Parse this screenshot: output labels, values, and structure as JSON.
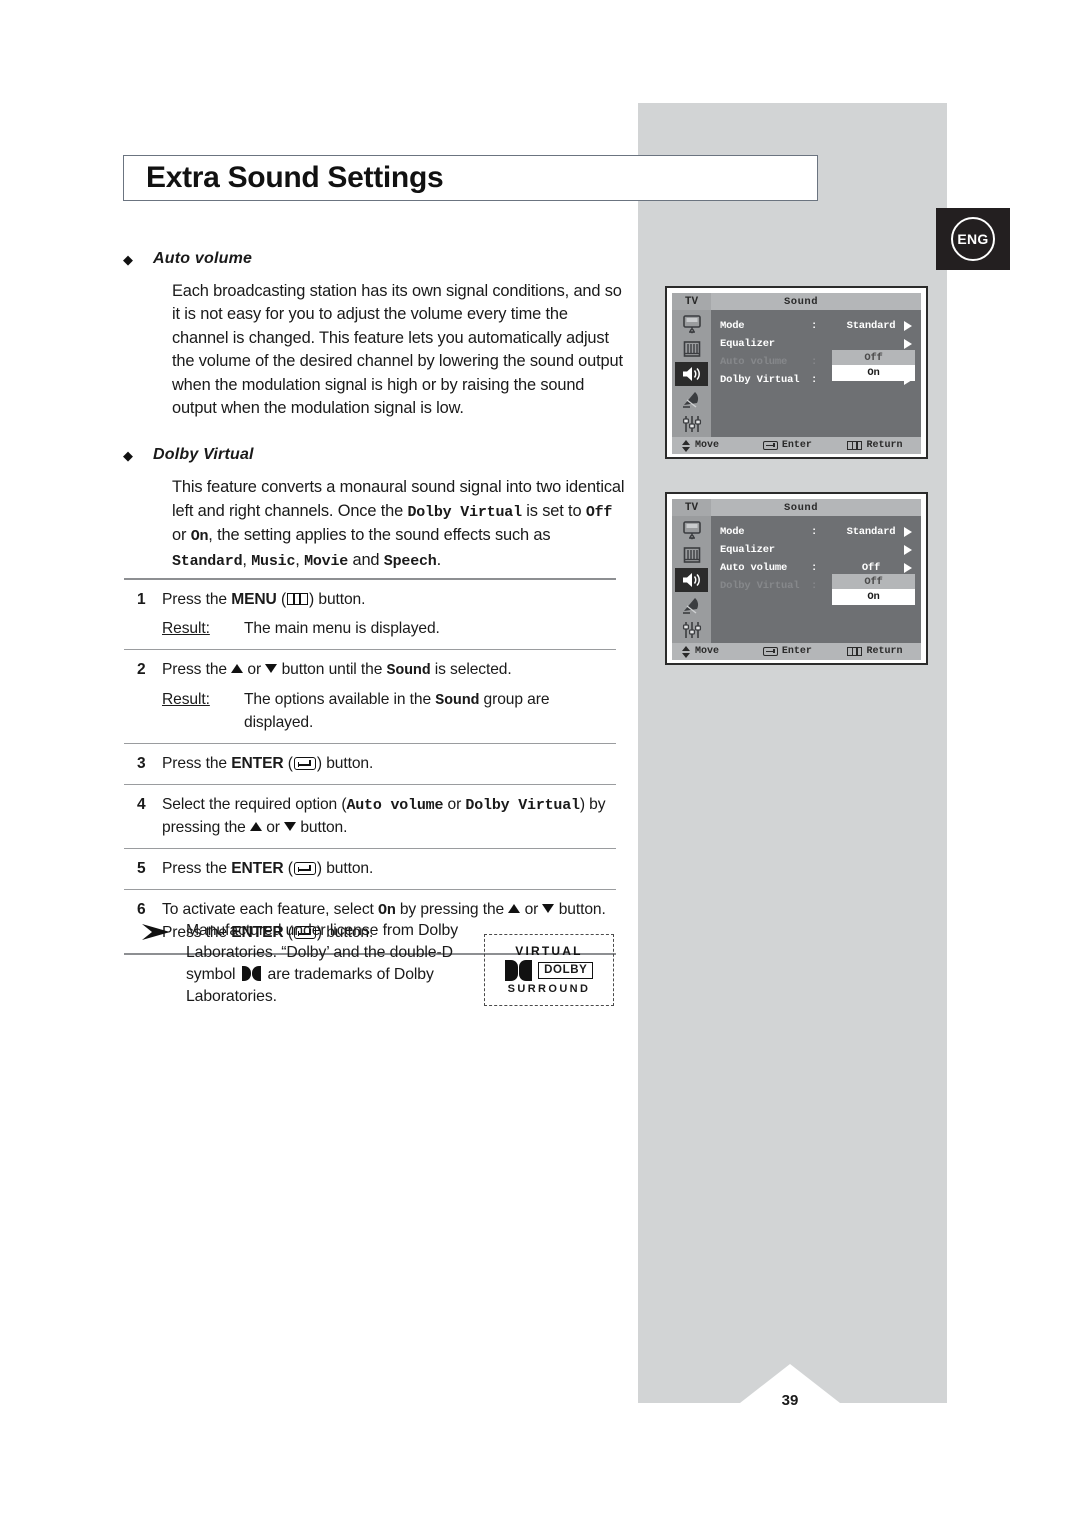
{
  "page": {
    "title": "Extra Sound Settings",
    "language_badge": "ENG",
    "page_number": "39"
  },
  "sections": [
    {
      "heading": "Auto volume",
      "body": "Each broadcasting station has its own signal conditions, and so it is not easy for you to adjust the volume every time the channel is changed. This feature lets you automatically adjust the volume of the desired channel by lowering the sound output when the modulation signal is high or by raising the sound output when the modulation signal is low."
    },
    {
      "heading": "Dolby Virtual",
      "body_parts": {
        "p1": "This feature converts a monaural sound signal into two identical left and right channels. Once the ",
        "m1": "Dolby Virtual",
        "p2": " is set to ",
        "m2": "Off",
        "p3": " or ",
        "m3": "On",
        "p4": ", the setting applies to the sound effects such as ",
        "m4": "Standard",
        "p5": ", ",
        "m5": "Music",
        "p6": ", ",
        "m6": "Movie",
        "p7": " and ",
        "m7": "Speech",
        "p8": "."
      }
    }
  ],
  "steps": [
    {
      "num": "1",
      "parts": {
        "a": "Press the ",
        "bold": "MENU",
        "b": " (",
        "icon": "menu-icon",
        "c": ")  button."
      },
      "result_label": "Result:",
      "result_text": "The main menu is displayed."
    },
    {
      "num": "2",
      "parts": {
        "a": "Press the ",
        "up": "▲",
        "b": " or ",
        "down": "▼",
        "c": " button until the ",
        "mono": "Sound",
        "d": " is selected."
      },
      "result_label": "Result:",
      "result_parts": {
        "a": "The options available in the ",
        "mono": "Sound",
        "b": " group are displayed."
      }
    },
    {
      "num": "3",
      "parts": {
        "a": "Press the ",
        "bold": "ENTER",
        "b": " (",
        "icon": "enter-icon",
        "c": ") button."
      }
    },
    {
      "num": "4",
      "parts": {
        "a": "Select the required option (",
        "mono1": "Auto volume",
        "b": " or ",
        "mono2": "Dolby Virtual",
        "c": ") by pressing the ",
        "up": "▲",
        "d": " or ",
        "down": "▼",
        "e": " button."
      }
    },
    {
      "num": "5",
      "parts": {
        "a": "Press the ",
        "bold": "ENTER",
        "b": " (",
        "icon": "enter-icon",
        "c": ") button."
      }
    },
    {
      "num": "6",
      "parts": {
        "a": "To activate each feature, select ",
        "mono": "On",
        "b": " by pressing the ",
        "up": "▲",
        "c": " or ",
        "down": "▼",
        "d": " button. Press the ",
        "bold": "ENTER",
        "e": " (",
        "icon": "enter-icon",
        "f": ") button."
      }
    }
  ],
  "note": {
    "arrow_icon": "arrowhead-icon",
    "parts": {
      "a": "Manufactured under license from Dolby Laboratories. “Dolby’ and the double-D symbol ",
      "symbol": "double-d-icon",
      "b": " are trademarks of Dolby Laboratories."
    }
  },
  "dolby_logo": {
    "virtual": "VIRTUAL",
    "dolby": "DOLBY",
    "surround": "SURROUND"
  },
  "osd_menus": [
    {
      "tv_label": "TV",
      "title": "Sound",
      "sidebar_icons": [
        "picture-icon",
        "equalizer-icon",
        "speaker-icon",
        "satellite-dish-icon",
        "setup-sliders-icon"
      ],
      "selected_sidebar_index": 2,
      "rows": [
        {
          "label": "Mode",
          "colon": ":",
          "value": "Standard",
          "dim": false,
          "arrow": true
        },
        {
          "label": "Equalizer",
          "colon": "",
          "value": "",
          "dim": false,
          "arrow": true
        },
        {
          "label": "Auto volume",
          "colon": ":",
          "value": "Off",
          "dim": true,
          "arrow": true
        },
        {
          "label": "Dolby Virtual",
          "colon": ":",
          "value": "On",
          "dim": false,
          "arrow": true
        }
      ],
      "dropdown": {
        "on_row": 2,
        "off": "Off",
        "on": "On"
      },
      "footer": {
        "move": "Move",
        "enter": "Enter",
        "return": "Return"
      }
    },
    {
      "tv_label": "TV",
      "title": "Sound",
      "sidebar_icons": [
        "picture-icon",
        "equalizer-icon",
        "speaker-icon",
        "satellite-dish-icon",
        "setup-sliders-icon"
      ],
      "selected_sidebar_index": 2,
      "rows": [
        {
          "label": "Mode",
          "colon": ":",
          "value": "Standard",
          "dim": false,
          "arrow": true
        },
        {
          "label": "Equalizer",
          "colon": "",
          "value": "",
          "dim": false,
          "arrow": true
        },
        {
          "label": "Auto volume",
          "colon": ":",
          "value": "Off",
          "dim": false,
          "arrow": true
        },
        {
          "label": "Dolby Virtual",
          "colon": ":",
          "value": "",
          "dim": true,
          "arrow": true
        }
      ],
      "dropdown": {
        "on_row": 3,
        "off": "Off",
        "on": "On"
      },
      "footer": {
        "move": "Move",
        "enter": "Enter",
        "return": "Return"
      }
    }
  ],
  "colors": {
    "panel_gray": "#d2d4d5",
    "badge_black": "#231f20",
    "osd_body": "#6e7073",
    "osd_bar": "#b4b6b8",
    "osd_sidebar": "#9a9c9e"
  }
}
